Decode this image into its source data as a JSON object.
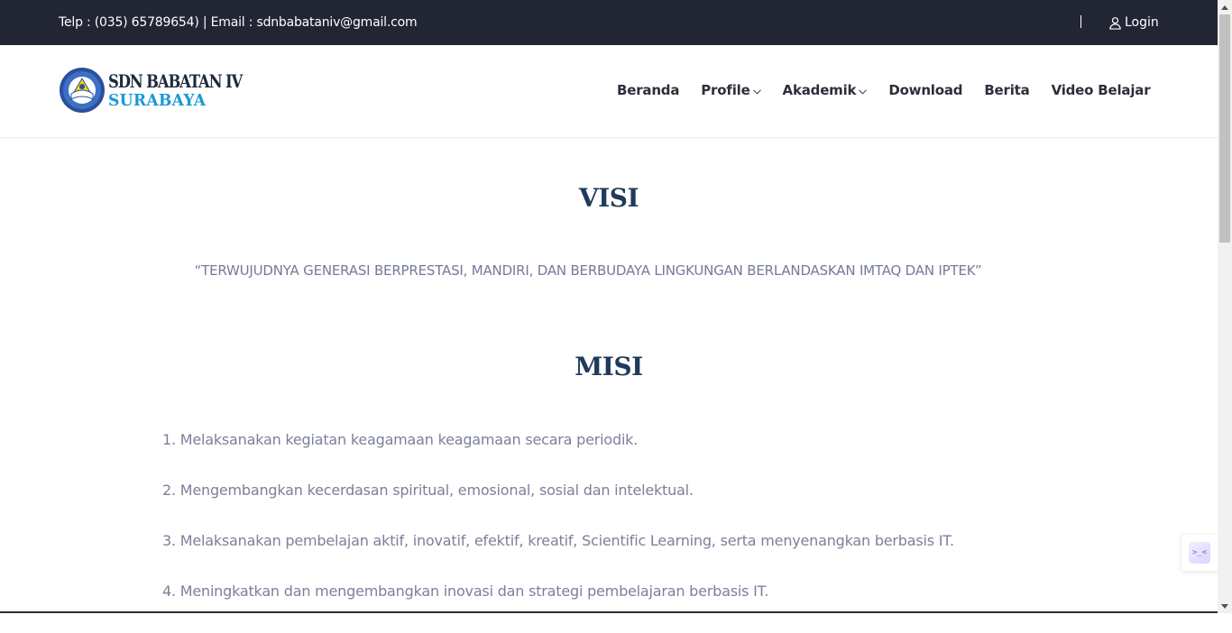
{
  "topbar": {
    "contact": "Telp : (035) 65789654) | Email : sdnbabataniv@gmail.com",
    "login_label": "Login",
    "login_icon": "user-icon"
  },
  "header": {
    "logo": {
      "line1": "SDN BABATAN IV",
      "line2": "SURABAYA",
      "emblem_icon": "tut-wuri-handayani-emblem"
    },
    "nav": [
      {
        "label": "Beranda",
        "dropdown": false
      },
      {
        "label": "Profile",
        "dropdown": true
      },
      {
        "label": "Akademik",
        "dropdown": true
      },
      {
        "label": "Download",
        "dropdown": false
      },
      {
        "label": "Berita",
        "dropdown": false
      },
      {
        "label": "Video Belajar",
        "dropdown": false
      }
    ]
  },
  "content": {
    "visi_title": "VISI",
    "visi_text": "“TERWUJUDNYA GENERASI BERPRESTASI, MANDIRI, DAN BERBUDAYA LINGKUNGAN BERLANDASKAN IMTAQ DAN IPTEK”",
    "misi_title": "MISI",
    "misi_items": [
      "1. Melaksanakan kegiatan keagamaan keagamaan secara periodik.",
      "2. Mengembangkan kecerdasan spiritual, emosional, sosial dan intelektual.",
      "3. Melaksanakan pembelajan aktif, inovatif, efektif, kreatif, Scientific Learning, serta menyenangkan berbasis IT.",
      "4. Meningkatkan dan mengembangkan inovasi dan strategi pembelajaran berbasis IT."
    ]
  },
  "floating_widget": {
    "glyph": ">_<"
  },
  "colors": {
    "topbar_bg": "#222534",
    "title": "#1f3b5a",
    "body_text": "#7c8099",
    "logo_blue": "#1899d6"
  }
}
